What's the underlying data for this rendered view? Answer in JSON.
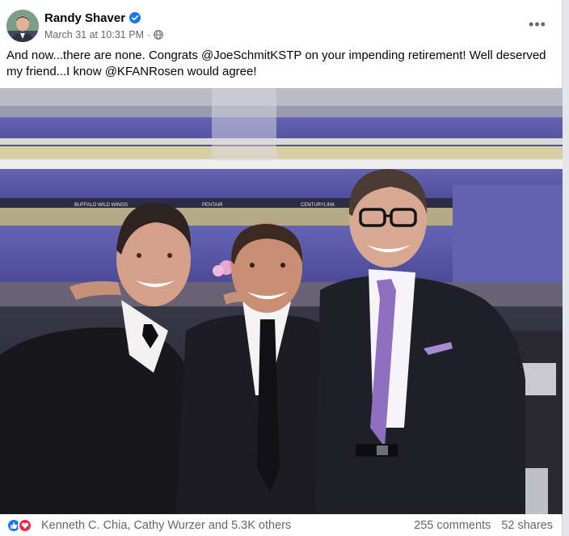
{
  "post": {
    "author": "Randy Shaver",
    "timestamp": "March 31 at 10:31 PM",
    "separator": "·",
    "privacy_icon": "globe-icon",
    "verified_icon": "verified-badge-icon",
    "more_icon": "more-options-icon",
    "more_label": "•••",
    "text": "And now...there are none. Congrats @JoeSchmitKSTP on your impending retirement! Well deserved my friend...I know @KFANRosen would agree!"
  },
  "photo": {
    "signs": [
      "BUFFALO WILD WINGS",
      "PENTAIR",
      "CENTURYLINK"
    ]
  },
  "footer": {
    "reaction_icons": [
      "like-icon",
      "love-icon"
    ],
    "reactions_text": "Kenneth C. Chia, Cathy Wurzer and 5.3K others",
    "comments": "255 comments",
    "shares": "52 shares"
  },
  "colors": {
    "accent": "#1877f2",
    "love": "#f0284a",
    "secondary_text": "#65676b",
    "stadium_purple": "#5b5aa8"
  }
}
